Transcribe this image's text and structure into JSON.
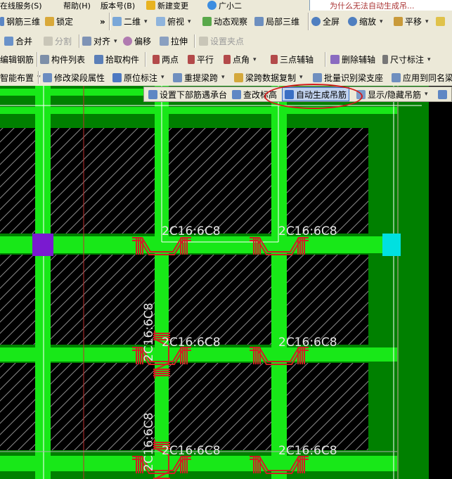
{
  "menubar": {
    "items": [
      "在线服务(S)",
      "帮助(H)",
      "版本号(B)",
      "新建变更",
      "广小二"
    ],
    "question": "为什么无法自动生成吊..."
  },
  "toolbar1": {
    "steel_3d": "钢筋三维",
    "lock": "锁定",
    "more": "»",
    "view_2d": "二维",
    "top_view": "俯视",
    "dynamic_view": "动态观察",
    "local_3d": "局部三维",
    "fullscreen": "全屏",
    "zoom": "缩放",
    "pan": "平移"
  },
  "toolbar2": {
    "merge": "合并",
    "split": "分割",
    "align": "对齐",
    "offset": "偏移",
    "stretch": "拉伸",
    "set_grip": "设置夹点"
  },
  "toolbar3": {
    "edit_rebar": "编辑钢筋",
    "component_list": "构件列表",
    "pick_component": "拾取构件",
    "two_points": "两点",
    "parallel": "平行",
    "point_angle": "点角",
    "three_point_aux": "三点辅轴",
    "delete_aux": "删除辅轴",
    "dimension": "尺寸标注"
  },
  "toolbar4": {
    "smart_layout": "智能布置",
    "modify_beam_attr": "修改梁段属性",
    "in_place_label": "原位标注",
    "re_span": "重提梁跨",
    "span_copy": "梁跨数据复制",
    "batch_identify": "批量识别梁支座",
    "apply_same_name": "应用到同名梁"
  },
  "floating_toolbar": {
    "set_bottom_rebar": "设置下部筋遇承台",
    "check_elevation": "查改标高",
    "auto_generate_hanger": "自动生成吊筋",
    "show_hide_hanger": "显示/隐藏吊筋"
  },
  "canvas": {
    "rebar_label_horizontal": "2C16:6C8",
    "rebar_label_vertical": "2C16:6C8",
    "colors": {
      "beam": "#18e818",
      "background": "#008000",
      "slab": "#000000",
      "hatch": "#8a8a8a",
      "hanger": "#cc2222",
      "column_left": "#7a1ad0",
      "column_right": "#00e0e0"
    }
  }
}
